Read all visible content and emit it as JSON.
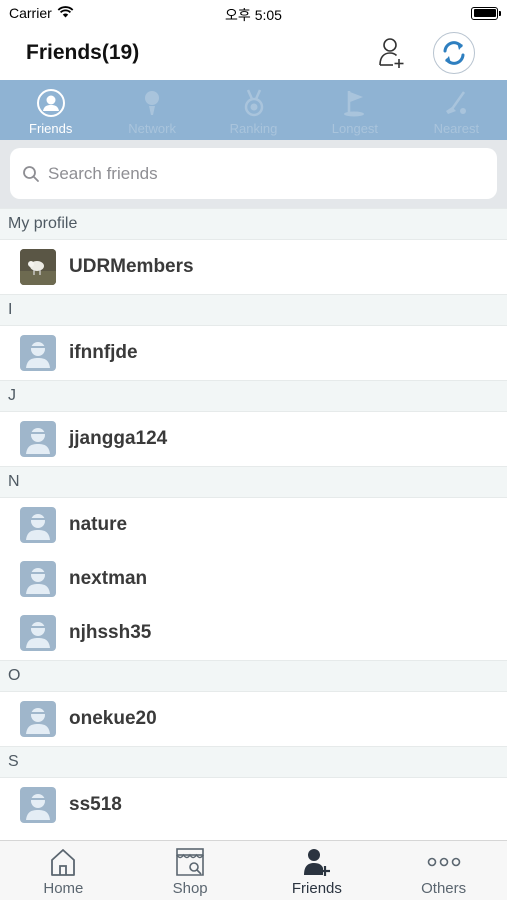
{
  "status": {
    "carrier": "Carrier",
    "time": "오후 5:05"
  },
  "header": {
    "title": "Friends(19)"
  },
  "tabs": [
    {
      "label": "Friends",
      "icon": "friends-icon",
      "active": true
    },
    {
      "label": "Network",
      "icon": "golf-ball-icon",
      "active": false
    },
    {
      "label": "Ranking",
      "icon": "medal-icon",
      "active": false
    },
    {
      "label": "Longest",
      "icon": "flag-icon",
      "active": false
    },
    {
      "label": "Nearest",
      "icon": "golf-club-icon",
      "active": false
    }
  ],
  "search": {
    "placeholder": "Search friends",
    "value": ""
  },
  "sections": [
    {
      "title": "My profile",
      "rows": [
        {
          "name": "UDRMembers",
          "avatar": "photo"
        }
      ]
    },
    {
      "title": "I",
      "rows": [
        {
          "name": "ifnnfjde",
          "avatar": "default"
        }
      ]
    },
    {
      "title": "J",
      "rows": [
        {
          "name": "jjangga124",
          "avatar": "default"
        }
      ]
    },
    {
      "title": "N",
      "rows": [
        {
          "name": "nature",
          "avatar": "default"
        },
        {
          "name": "nextman",
          "avatar": "default"
        },
        {
          "name": "njhssh35",
          "avatar": "default"
        }
      ]
    },
    {
      "title": "O",
      "rows": [
        {
          "name": "onekue20",
          "avatar": "default"
        }
      ]
    },
    {
      "title": "S",
      "rows": [
        {
          "name": "ss518",
          "avatar": "default"
        }
      ]
    }
  ],
  "bottom_nav": [
    {
      "label": "Home",
      "icon": "home-icon",
      "active": false
    },
    {
      "label": "Shop",
      "icon": "shop-icon",
      "active": false
    },
    {
      "label": "Friends",
      "icon": "friends-add-icon",
      "active": true
    },
    {
      "label": "Others",
      "icon": "more-icon",
      "active": false
    }
  ],
  "colors": {
    "tab_strip": "#8fb3d3",
    "tab_active": "#ffffff",
    "tab_inactive": "#a9c4dc",
    "avatar_default": "#9fb6cb",
    "refresh_accent": "#2e7fc0"
  }
}
